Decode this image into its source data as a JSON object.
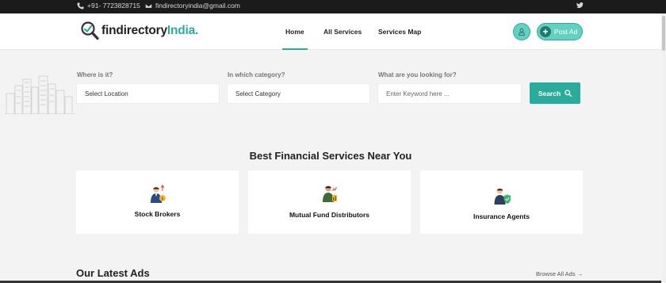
{
  "topbar": {
    "phone": "+91- 7723828715",
    "email": "findirectoryindia@gmail.com",
    "social_icon": "twitter-icon"
  },
  "header": {
    "logo_main": "findirectory",
    "logo_accent": "India",
    "logo_dot": ".",
    "nav": [
      "Home",
      "All Services",
      "Services Map"
    ],
    "active_nav": "Home",
    "post_ad_label": "Post Ad"
  },
  "search": {
    "location_label": "Where is it?",
    "location_value": "Select Location",
    "category_label": "In which category?",
    "category_value": "Select Category",
    "keyword_label": "What are you looking for?",
    "keyword_placeholder": "Enter Keyword here ...",
    "button_label": "Search"
  },
  "services": {
    "title": "Best Financial Services Near You",
    "cards": [
      {
        "label": "Stock Brokers",
        "icon": "stock-broker-icon"
      },
      {
        "label": "Mutual Fund Distributors",
        "icon": "mutual-fund-icon"
      },
      {
        "label": "Insurance Agents",
        "icon": "insurance-agent-icon"
      }
    ]
  },
  "latest": {
    "title": "Our Latest Ads",
    "browse_label": "Browse All Ads →"
  },
  "colors": {
    "accent": "#2bab9c",
    "accent_light": "#63d1c0",
    "topbar_bg": "#1b1b1b"
  }
}
